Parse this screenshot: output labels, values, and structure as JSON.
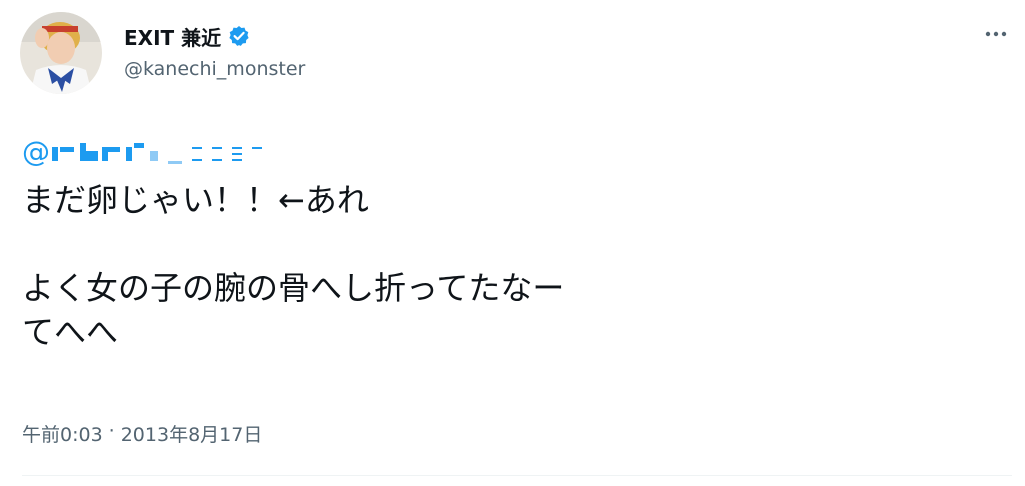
{
  "author": {
    "display_name": "EXIT 兼近",
    "handle": "@kanechi_monster",
    "verified_icon": "verified-badge-icon"
  },
  "actions": {
    "more_icon": "more-horizontal-icon"
  },
  "tweet": {
    "mention_prefix": "@",
    "mention_redacted_icon": "redacted-mention",
    "lines": [
      "まだ卵じゃい！！←あれ",
      "",
      "よく女の子の腕の骨へし折ってたなー",
      "てへへ"
    ],
    "time": "午前0:03",
    "separator": "·",
    "date": "2013年8月17日"
  },
  "colors": {
    "text": "#0f1419",
    "secondary": "#536471",
    "link": "#1d9bf0",
    "verified": "#1d9bf0",
    "divider": "#eff3f4"
  }
}
